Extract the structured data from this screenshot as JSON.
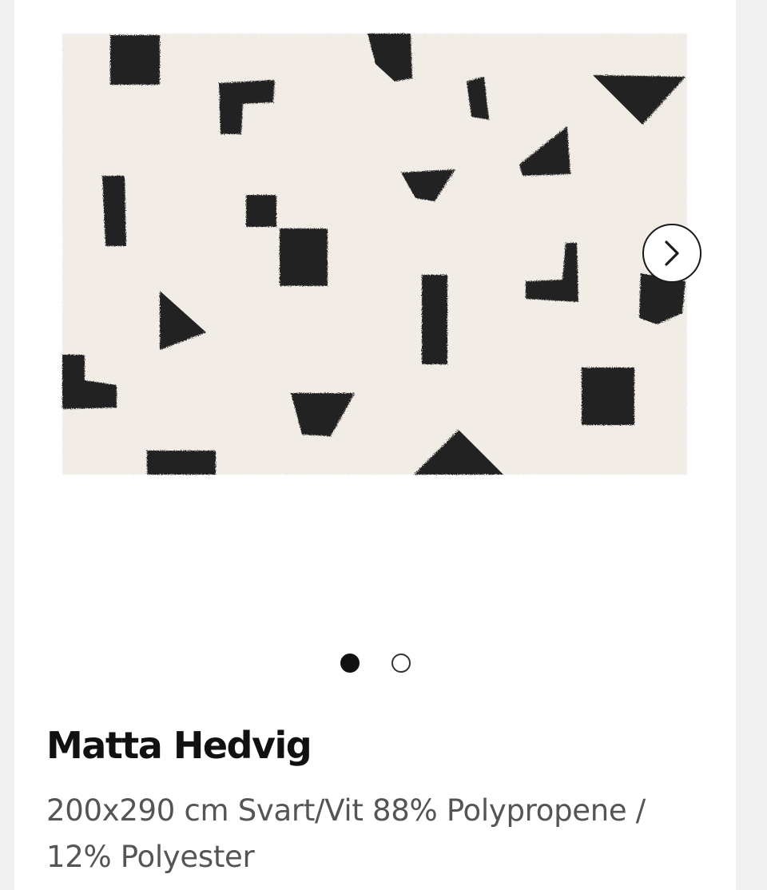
{
  "product": {
    "title": "Matta Hedvig",
    "description": "200x290 cm Svart/Vit 88% Polypropene / 12% Polyester"
  },
  "gallery": {
    "image_subject": "black-white-rug",
    "total_images": 2,
    "current_index": 1,
    "next_icon": "chevron-right-icon"
  },
  "colors": {
    "rug_base": "#f1ede6",
    "rug_pattern": "#242424",
    "title_text": "#111111",
    "description_text": "#555555",
    "page_background": "#f1f1f1",
    "card_background": "#ffffff"
  }
}
